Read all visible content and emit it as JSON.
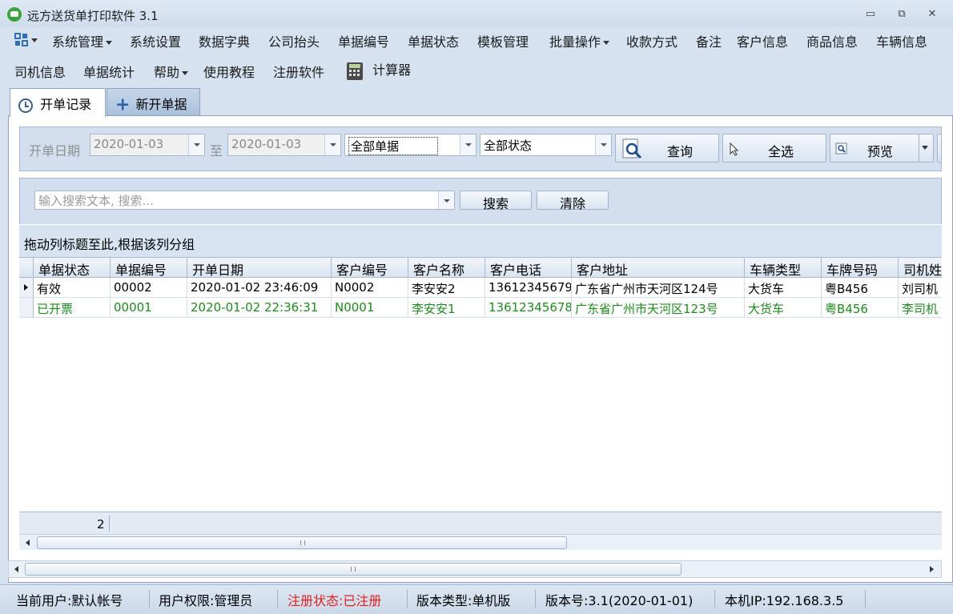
{
  "window": {
    "title": "远方送货单打印软件 3.1",
    "controls": {
      "minimize": "▭",
      "restore": "⧉",
      "close": "✕"
    }
  },
  "menu": {
    "row1": [
      "系统管理",
      "系统设置",
      "数据字典",
      "公司抬头",
      "单据编号",
      "单据状态",
      "模板管理",
      "批量操作",
      "收款方式",
      "备注",
      "客户信息",
      "商品信息",
      "车辆信息"
    ],
    "row2": [
      "司机信息",
      "单据统计",
      "帮助",
      "使用教程",
      "注册软件",
      "计算器"
    ]
  },
  "tabs": {
    "records": "开单记录",
    "new": "新开单据"
  },
  "filter": {
    "date_label": "开单日期",
    "date_from": "2020-01-03",
    "to_label": "至",
    "date_to": "2020-01-03",
    "type_value": "全部单据",
    "status_value": "全部状态",
    "query_label": "查询",
    "select_all_label": "全选",
    "preview_label": "预览"
  },
  "search": {
    "placeholder": "输入搜索文本, 搜索...",
    "search_label": "搜索",
    "clear_label": "清除"
  },
  "grid": {
    "group_hint": "拖动列标题至此,根据该列分组",
    "columns": [
      "单据状态",
      "单据编号",
      "开单日期",
      "客户编号",
      "客户名称",
      "客户电话",
      "客户地址",
      "车辆类型",
      "车牌号码",
      "司机姓"
    ],
    "rows": [
      {
        "status": "有效",
        "no": "00002",
        "date": "2020-01-02 23:46:09",
        "cust_no": "N0002",
        "cust_name": "李安安2",
        "phone": "13612345679",
        "address": "广东省广州市天河区124号",
        "vehicle": "大货车",
        "plate": "粤B456",
        "driver": "刘司机"
      },
      {
        "status": "已开票",
        "no": "00001",
        "date": "2020-01-02 22:36:31",
        "cust_no": "N0001",
        "cust_name": "李安安1",
        "phone": "13612345678",
        "address": "广东省广州市天河区123号",
        "vehicle": "大货车",
        "plate": "粤B456",
        "driver": "李司机"
      }
    ],
    "footer_count": "2",
    "green_color": "#1f8a1f"
  },
  "statusbar": {
    "user": "当前用户:默认帐号",
    "permission": "用户权限:管理员",
    "register": "注册状态:已注册",
    "edition": "版本类型:单机版",
    "version": "版本号:3.1(2020-01-01)",
    "ip": "本机IP:192.168.3.5",
    "register_color": "#e02020"
  }
}
